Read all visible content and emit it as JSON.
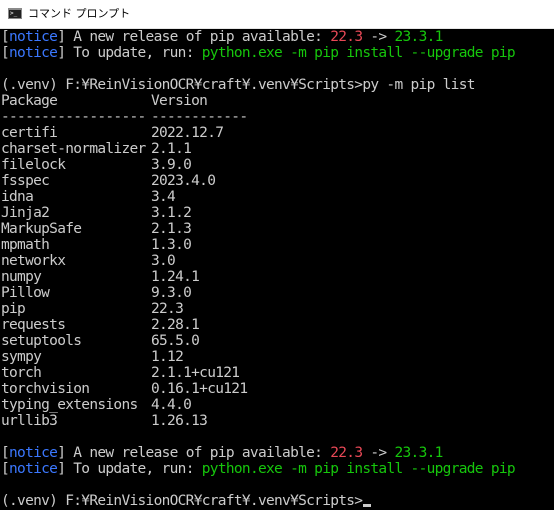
{
  "window": {
    "title": "コマンド プロンプト",
    "icon": "cmd-icon",
    "icon_glyph": ">_"
  },
  "colors": {
    "background": "#000000",
    "text": "#cccccc",
    "notice": "#3b78ff",
    "version_old": "#e74856",
    "version_new": "#16c60c"
  },
  "notice_top": {
    "line1": {
      "bracket_open": "[",
      "tag": "notice",
      "bracket_close": "]",
      "text": " A new release of pip available: ",
      "old_version": "22.3",
      "arrow": " -> ",
      "new_version": "23.3.1"
    },
    "line2": {
      "bracket_open": "[",
      "tag": "notice",
      "bracket_close": "]",
      "text": " To update, run: ",
      "command": "python.exe -m pip install --upgrade pip"
    }
  },
  "command_line": {
    "prompt": "(.venv) F:¥ReinVisionOCR¥craft¥.venv¥Scripts>",
    "command": "py -m pip list"
  },
  "table": {
    "header_package": "Package",
    "header_version": "Version",
    "separator_package": "------------------",
    "separator_version": "------------",
    "rows": [
      {
        "name": "certifi",
        "version": "2022.12.7"
      },
      {
        "name": "charset-normalizer",
        "version": "2.1.1"
      },
      {
        "name": "filelock",
        "version": "3.9.0"
      },
      {
        "name": "fsspec",
        "version": "2023.4.0"
      },
      {
        "name": "idna",
        "version": "3.4"
      },
      {
        "name": "Jinja2",
        "version": "3.1.2"
      },
      {
        "name": "MarkupSafe",
        "version": "2.1.3"
      },
      {
        "name": "mpmath",
        "version": "1.3.0"
      },
      {
        "name": "networkx",
        "version": "3.0"
      },
      {
        "name": "numpy",
        "version": "1.24.1"
      },
      {
        "name": "Pillow",
        "version": "9.3.0"
      },
      {
        "name": "pip",
        "version": "22.3"
      },
      {
        "name": "requests",
        "version": "2.28.1"
      },
      {
        "name": "setuptools",
        "version": "65.5.0"
      },
      {
        "name": "sympy",
        "version": "1.12"
      },
      {
        "name": "torch",
        "version": "2.1.1+cu121"
      },
      {
        "name": "torchvision",
        "version": "0.16.1+cu121"
      },
      {
        "name": "typing_extensions",
        "version": "4.4.0"
      },
      {
        "name": "urllib3",
        "version": "1.26.13"
      }
    ]
  },
  "notice_bottom": {
    "line1": {
      "bracket_open": "[",
      "tag": "notice",
      "bracket_close": "]",
      "text": " A new release of pip available: ",
      "old_version": "22.3",
      "arrow": " -> ",
      "new_version": "23.3.1"
    },
    "line2": {
      "bracket_open": "[",
      "tag": "notice",
      "bracket_close": "]",
      "text": " To update, run: ",
      "command": "python.exe -m pip install --upgrade pip"
    }
  },
  "final_prompt": {
    "prompt": "(.venv) F:¥ReinVisionOCR¥craft¥.venv¥Scripts>"
  }
}
